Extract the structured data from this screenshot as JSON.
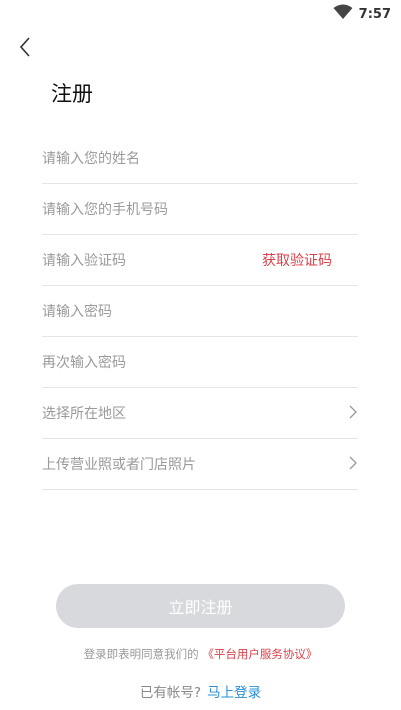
{
  "status_bar": {
    "time": "7:57"
  },
  "header": {
    "title": "注册"
  },
  "form": {
    "name_placeholder": "请输入您的姓名",
    "phone_placeholder": "请输入您的手机号码",
    "code_placeholder": "请输入验证码",
    "get_code_label": "获取验证码",
    "password_placeholder": "请输入密码",
    "confirm_password_placeholder": "再次输入密码",
    "region_label": "选择所在地区",
    "upload_label": "上传营业照或者门店照片"
  },
  "submit": {
    "label": "立即注册"
  },
  "agreement": {
    "prefix": "登录即表明同意我们的",
    "link": "《平台用户服务协议》"
  },
  "login": {
    "prefix": "已有帐号?",
    "link": "马上登录"
  }
}
